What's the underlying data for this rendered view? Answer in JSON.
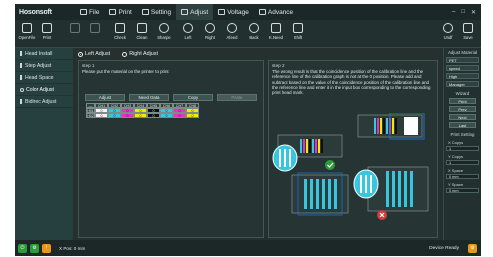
{
  "app": {
    "logo": "Hosonsoft"
  },
  "menu": [
    {
      "label": "File"
    },
    {
      "label": "Print"
    },
    {
      "label": "Setting"
    },
    {
      "label": "Adjust"
    },
    {
      "label": "Voltage"
    },
    {
      "label": "Advance"
    }
  ],
  "toolbar": {
    "left": [
      {
        "label": "OpenFile",
        "icon": "open-file-icon"
      },
      {
        "label": "Print",
        "icon": "print-icon"
      }
    ],
    "middle": [
      {
        "label": "",
        "icon": "disabled-icon"
      },
      {
        "label": "",
        "icon": "disabled-icon"
      },
      {
        "label": "Check",
        "icon": "check-icon"
      },
      {
        "label": "Clean",
        "icon": "clean-icon"
      },
      {
        "label": "Sharpe",
        "icon": "sharpe-icon"
      },
      {
        "label": "Left",
        "icon": "left-icon"
      },
      {
        "label": "Right",
        "icon": "right-icon"
      },
      {
        "label": "Afeed",
        "icon": "afeed-icon"
      },
      {
        "label": "Back",
        "icon": "back-icon"
      },
      {
        "label": "K.Need",
        "icon": "home-icon"
      },
      {
        "label": "Shift",
        "icon": "shift-icon"
      }
    ],
    "right": [
      {
        "label": "Undf",
        "icon": "refresh-icon"
      },
      {
        "label": "Save",
        "icon": "save-icon"
      }
    ]
  },
  "leftnav": [
    {
      "label": "Head Install",
      "active": false
    },
    {
      "label": "Step Adjust",
      "active": false
    },
    {
      "label": "Head Space",
      "active": false
    },
    {
      "label": "Color Adjust",
      "active": true
    },
    {
      "label": "Bidirec Adjust",
      "active": false
    }
  ],
  "main": {
    "tabs": [
      {
        "label": "Left Adjust",
        "selected": true
      },
      {
        "label": "Right Adjust",
        "selected": false
      }
    ],
    "step1": {
      "title": "step 1",
      "text": "Please put the material on the printer to print",
      "buttons": [
        {
          "label": "Adjust"
        },
        {
          "label": "Need Data"
        },
        {
          "label": "Copy"
        },
        {
          "label": "Paste"
        }
      ],
      "grid": {
        "header": [
          "—",
          "CH1",
          "CH2",
          "CH3",
          "CH4",
          "CH5",
          "CH6",
          "CH7",
          "CH8"
        ],
        "rows": [
          {
            "label": "H01",
            "values": [
              "0",
              "0",
              "0",
              "0",
              "0",
              "0",
              "0",
              "0"
            ]
          },
          {
            "label": "H02",
            "values": [
              "0",
              "0",
              "0",
              "0",
              "0",
              "0",
              "0",
              "0"
            ]
          }
        ],
        "colors": [
          "w",
          "c",
          "m",
          "y",
          "k",
          "c",
          "m",
          "y"
        ]
      }
    },
    "step2": {
      "title": "step 2",
      "text": "The wrong result is that the coincidence position of the calibration line and the reference line of the calibration graph is not at the 0 position. Please add and subtract based on the value of the coincidence position of the calibration line and the reference line and enter it in the input box corresponding to the corresponding print head mark."
    }
  },
  "rightpanel": {
    "material_title": "Adjust Material",
    "materials": [
      "PET",
      "speed",
      "High",
      "Manager"
    ],
    "wizard_title": "Wizard",
    "wizard_buttons": [
      "Print",
      "Prev",
      "Next",
      "Last"
    ],
    "print_title": "Print Setting",
    "fields": [
      {
        "label": "X Copys",
        "value": "1"
      },
      {
        "label": "Y Copys",
        "value": "1"
      },
      {
        "label": "X Space",
        "value": "0 mm"
      },
      {
        "label": "Y Space",
        "value": "0 mm"
      }
    ]
  },
  "status": {
    "left_text": "X Pos: 0 mm",
    "right_text": "Device Ready"
  },
  "colors": {
    "accent_green": "#2e9b3a",
    "accent_orange": "#e8961e"
  }
}
